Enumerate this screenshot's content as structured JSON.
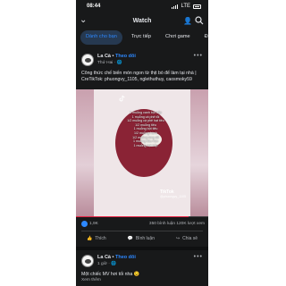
{
  "status": {
    "time": "08:44",
    "network": "LTE"
  },
  "header": {
    "title": "Watch"
  },
  "tabs": [
    {
      "label": "Dành cho bạn",
      "active": true
    },
    {
      "label": "Trực tiếp",
      "active": false
    },
    {
      "label": "Chơi game",
      "active": false
    },
    {
      "label": "Đang th",
      "active": false
    }
  ],
  "post1": {
    "author": "La Cà",
    "follow": "Theo dõi",
    "time": "Thứ Hai",
    "caption": "Công thức chế biến món ngon từ thịt bò để làm tại nhà | CreTikTok: phuongvy_1105, nglethuthuy, caosmoky59",
    "video_overlay_text": "1 muỗng canh bột bắp\n1 muỗng cà phê tỏi\n1/2 muỗng cà phê hạt tiêu\n1/2 muỗng tiêu\n1 muỗng bột tiêu\n1/2 muỗng hành\n1/2 muỗng lòng đỏ\n1 muỗng dầu hào\n1 muỗng bột bắp",
    "watermark_brand": "TikTok",
    "watermark_handle": "@phuongvy_1105",
    "progress": 0.85,
    "likes": "1,9K",
    "stats_right": "350 bình luận   120K lượt xem",
    "actions": {
      "like": "Thích",
      "comment": "Bình luận",
      "share": "Chia sẻ"
    }
  },
  "post2": {
    "author": "La Cà",
    "follow": "Theo dõi",
    "time": "1 giờ",
    "caption": "Một chiếc MV hơi tối nha 😉",
    "see_more": "Xem thêm"
  },
  "colors": {
    "accent": "#2d88ff",
    "background": "#18191a",
    "progress": "#e41e3f"
  },
  "icons": [
    "back-chevron-icon",
    "person-icon",
    "search-icon",
    "more-icon",
    "like-icon",
    "comment-icon",
    "share-icon",
    "tiktok-icon",
    "globe-icon"
  ]
}
